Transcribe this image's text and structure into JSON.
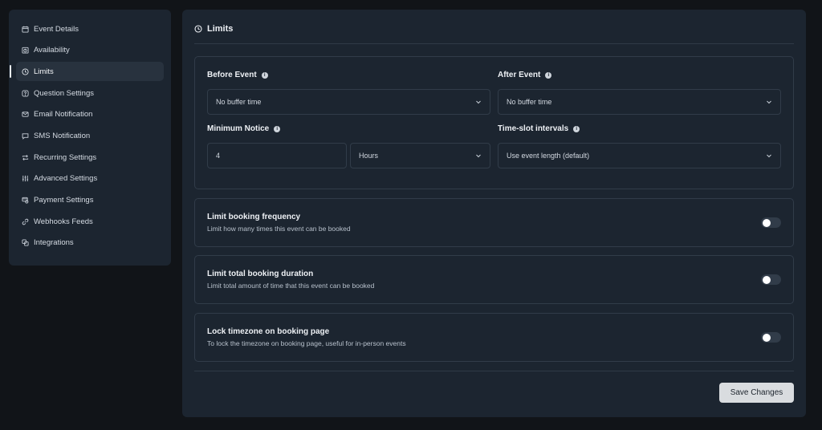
{
  "sidebar": {
    "items": [
      {
        "label": "Event Details",
        "icon": "calendar-icon"
      },
      {
        "label": "Availability",
        "icon": "clock-calendar-icon"
      },
      {
        "label": "Limits",
        "icon": "clock-icon",
        "active": true
      },
      {
        "label": "Question Settings",
        "icon": "question-icon"
      },
      {
        "label": "Email Notification",
        "icon": "mail-icon"
      },
      {
        "label": "SMS Notification",
        "icon": "message-icon"
      },
      {
        "label": "Recurring Settings",
        "icon": "repeat-icon"
      },
      {
        "label": "Advanced Settings",
        "icon": "sliders-icon"
      },
      {
        "label": "Payment Settings",
        "icon": "payment-icon"
      },
      {
        "label": "Webhooks Feeds",
        "icon": "link-icon"
      },
      {
        "label": "Integrations",
        "icon": "integrations-icon"
      }
    ]
  },
  "main": {
    "title": "Limits",
    "before_event": {
      "label": "Before Event",
      "value": "No buffer time"
    },
    "after_event": {
      "label": "After Event",
      "value": "No buffer time"
    },
    "minimum_notice": {
      "label": "Minimum Notice",
      "value": "4",
      "unit": "Hours"
    },
    "time_slot": {
      "label": "Time-slot intervals",
      "value": "Use event length (default)"
    },
    "toggles": [
      {
        "title": "Limit booking frequency",
        "desc": "Limit how many times this event can be booked",
        "on": false
      },
      {
        "title": "Limit total booking duration",
        "desc": "Limit total amount of time that this event can be booked",
        "on": false
      },
      {
        "title": "Lock timezone on booking page",
        "desc": "To lock the timezone on booking page, useful for in-person events",
        "on": false
      }
    ],
    "save_label": "Save Changes"
  },
  "colors": {
    "background": "#111418",
    "panel": "#1c2530",
    "border": "#313c49",
    "active_item": "#28323e",
    "button": "#d9dcdf"
  }
}
